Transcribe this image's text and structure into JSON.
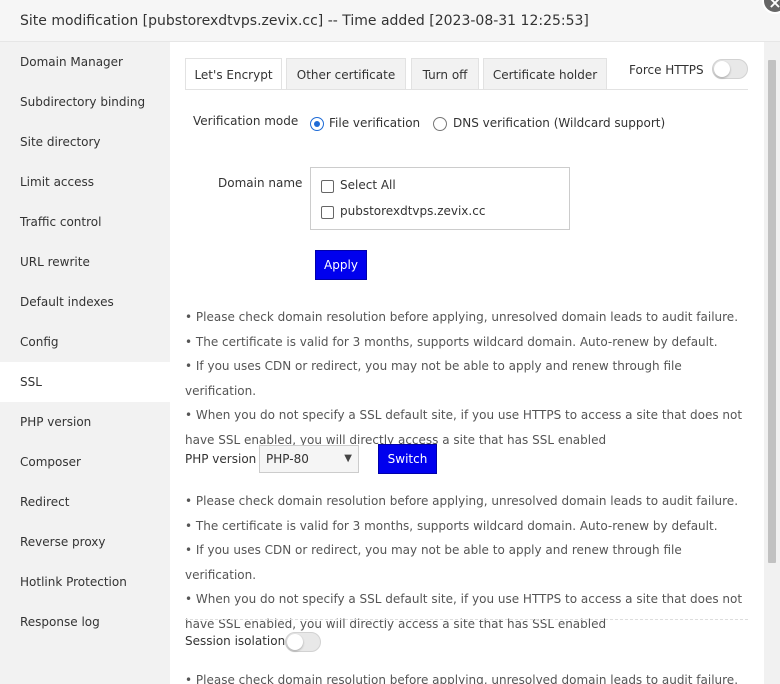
{
  "window": {
    "title": "Site modification [pubstorexdtvps.zevix.cc] -- Time added [2023-08-31 12:25:53]",
    "close_glyph": "×"
  },
  "sidebar": {
    "items": [
      {
        "label": "Domain Manager"
      },
      {
        "label": "Subdirectory binding"
      },
      {
        "label": "Site directory"
      },
      {
        "label": "Limit access"
      },
      {
        "label": "Traffic control"
      },
      {
        "label": "URL rewrite"
      },
      {
        "label": "Default indexes"
      },
      {
        "label": "Config"
      },
      {
        "label": "SSL",
        "active": true
      },
      {
        "label": "PHP version"
      },
      {
        "label": "Composer"
      },
      {
        "label": "Redirect"
      },
      {
        "label": "Reverse proxy"
      },
      {
        "label": "Hotlink Protection"
      },
      {
        "label": "Response log"
      }
    ]
  },
  "tabs": [
    {
      "label": "Let's Encrypt",
      "active": true
    },
    {
      "label": "Other certificate"
    },
    {
      "label": "Turn off"
    },
    {
      "label": "Certificate holder"
    }
  ],
  "force_https": {
    "label": "Force HTTPS",
    "enabled": false
  },
  "verification": {
    "label": "Verification mode",
    "options": [
      {
        "label": "File verification",
        "checked": true
      },
      {
        "label": "DNS verification (Wildcard support)",
        "checked": false
      }
    ]
  },
  "domain": {
    "label": "Domain name",
    "options": [
      {
        "label": "Select All",
        "checked": false
      },
      {
        "label": "pubstorexdtvps.zevix.cc",
        "checked": false
      }
    ]
  },
  "apply_label": "Apply",
  "notes_1": [
    "• Please check domain resolution before applying, unresolved domain leads to audit failure.",
    "• The certificate is valid for 3 months, supports wildcard domain. Auto-renew by default.",
    "• If you uses CDN or redirect, you may not be able to apply and renew through file verification.",
    "• When you do not specify a SSL default site, if you use HTTPS to access a site that does not have SSL enabled, you will directly access a site that has SSL enabled"
  ],
  "php": {
    "label": "PHP version",
    "selected": "PHP-80",
    "switch_label": "Switch"
  },
  "notes_2": [
    "• Please check domain resolution before applying, unresolved domain leads to audit failure.",
    "• The certificate is valid for 3 months, supports wildcard domain. Auto-renew by default.",
    "• If you uses CDN or redirect, you may not be able to apply and renew through file verification.",
    "• When you do not specify a SSL default site, if you use HTTPS to access a site that does not have SSL enabled, you will directly access a site that has SSL enabled"
  ],
  "session": {
    "label": "Session isolation",
    "enabled": false
  },
  "notes_3": [
    "• Please check domain resolution before applying, unresolved domain leads to audit failure."
  ]
}
